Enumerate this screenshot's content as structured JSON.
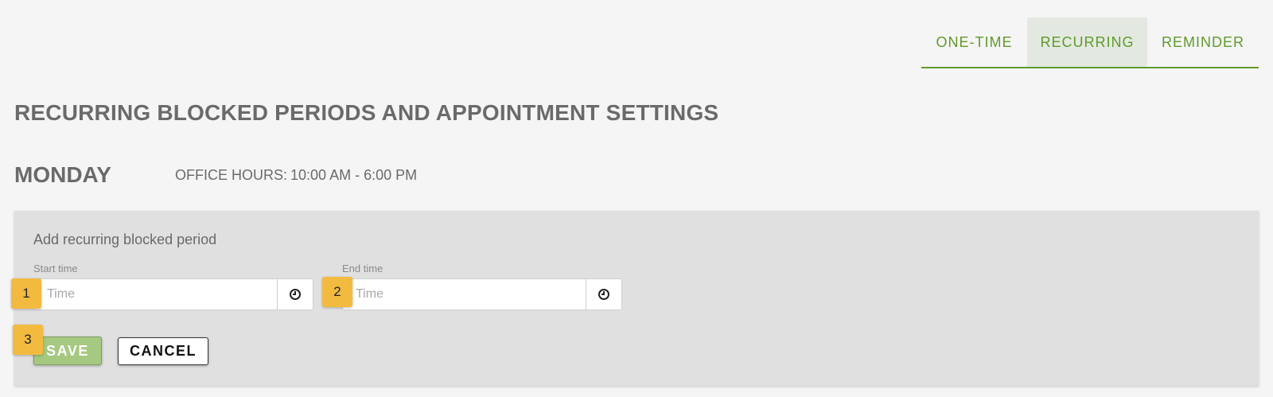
{
  "tabs": [
    {
      "label": "ONE-TIME"
    },
    {
      "label": "RECURRING"
    },
    {
      "label": "REMINDER"
    }
  ],
  "active_tab": "RECURRING",
  "page_title": "RECURRING BLOCKED PERIODS AND APPOINTMENT SETTINGS",
  "day": {
    "name": "MONDAY",
    "office_hours_label": "OFFICE HOURS:",
    "office_hours_value": "10:00 AM - 6:00 PM"
  },
  "form": {
    "title": "Add recurring blocked period",
    "start": {
      "label": "Start time",
      "placeholder": "Time",
      "value": ""
    },
    "end": {
      "label": "End time",
      "placeholder": "Time",
      "value": ""
    },
    "save_label": "SAVE",
    "cancel_label": "CANCEL"
  },
  "markers": [
    "1",
    "2",
    "3"
  ],
  "colors": {
    "accent": "#5f9a2a",
    "active_tab_bg": "#e3e9e0",
    "save_bg": "#a5c980",
    "marker": "#f2bb3f",
    "panel_bg": "#e0e0e0"
  },
  "icons": {
    "time_picker": "clock-icon"
  }
}
